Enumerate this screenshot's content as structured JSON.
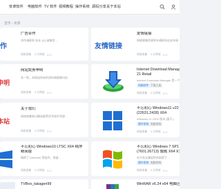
{
  "nav": {
    "items": [
      "安卓软件",
      "电脑软件",
      "TV 软件",
      "视频教程",
      "操作系统",
      "源码分享",
      "关于本站"
    ]
  },
  "breadcrumb": "首页 › 资源",
  "cards": [
    {
      "id": "ad-left",
      "thumb_text": "合作",
      "title": "广告合作",
      "desc": "合作请联系 站长 QQ 或微信…",
      "author": "网络收集",
      "time": "0 分钟前",
      "views": "⊙ 0"
    },
    {
      "id": "links",
      "thumb_text": "友情链接",
      "title": "友情链接",
      "desc": "网络收集资源发布请联系站长申请添加…",
      "author": "网络收集",
      "time": "0 分钟前",
      "views": "⊙ 0"
    },
    {
      "id": "disclaimer",
      "thumb_text": "申明",
      "title": "网站免责申明",
      "desc": "本一免，本网站所有的资料和图像均仅…",
      "author": "网络收集",
      "time": "0 分钟前",
      "views": "⊙ 0"
    },
    {
      "id": "idm",
      "title_line1": "Internet Download Manager 6",
      "title_line2": "21 Retail",
      "desc": "Internet Download Manager 是一个…",
      "tag1": "电脑软件",
      "tag2": "下载工具",
      "author": "网络收集",
      "time": "0 分钟前",
      "views": "⊙ 0"
    },
    {
      "id": "about",
      "thumb_text": "本站",
      "title": "关于我们",
      "desc": "网络收集每日精选推荐优秀软件资源…",
      "author": "网络收集",
      "time": "0 分钟前",
      "views": "⊙ 0"
    },
    {
      "id": "win11",
      "title_line1": "不忘初心 Windows11 v22",
      "title_line2": "(22631.2428) X64",
      "desc": "Windows 11 22H2 版本 [基于]…",
      "tag1": "操作系统",
      "tag2": "电脑系统",
      "author": "网络收集",
      "time": "0 分钟前",
      "views": "⊙ 0"
    },
    {
      "id": "win10ltsc",
      "title_line1": "不忘初心 Windows10 LTSC X64 纯净",
      "title_line2": "精简版",
      "desc": "精简了 Defender 等组件，保留…",
      "author": "网络收集",
      "time": "0 分钟前",
      "views": "⊙ 0"
    },
    {
      "id": "win7",
      "title_line1": "不忘初心 Windows 7 SP1 [",
      "title_line2": "(7601.26713) 旗舰 X64 X1 …",
      "desc": "在不失去兼容性的前提下…",
      "tag1": "操作系统",
      "tag2": "电脑系统",
      "author": "网络收集",
      "time": "0 分钟前",
      "views": "⊙ 0"
    },
    {
      "id": "tvbox",
      "title": "TVBox_takagen99"
    },
    {
      "id": "winrar",
      "title": "WinRAR v6.24 x64 电脑压…"
    }
  ],
  "colors": {
    "accent": "#2f7be0",
    "red": "#e23b3b",
    "blue_text": "#2766c8",
    "green": "#2aa53a",
    "windows": "#1f6fd1"
  }
}
